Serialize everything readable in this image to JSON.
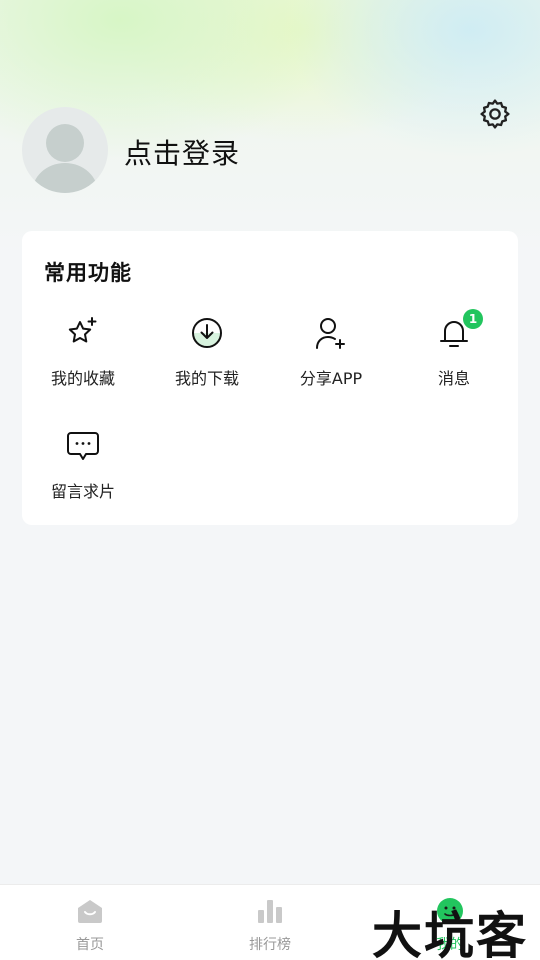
{
  "header": {
    "login_label": "点击登录",
    "settings_icon": "gear-icon",
    "avatar_icon": "default-avatar-icon"
  },
  "features_card": {
    "title": "常用功能",
    "items": [
      {
        "label": "我的收藏",
        "icon": "star-sparkle-icon"
      },
      {
        "label": "我的下载",
        "icon": "download-circle-icon"
      },
      {
        "label": "分享APP",
        "icon": "add-user-icon"
      },
      {
        "label": "消息",
        "icon": "bell-icon",
        "badge": "1"
      },
      {
        "label": "留言求片",
        "icon": "chat-bubble-icon"
      }
    ]
  },
  "tabbar": {
    "tabs": [
      {
        "label": "首页",
        "icon": "home-icon",
        "active": false
      },
      {
        "label": "排行榜",
        "icon": "bar-chart-icon",
        "active": false
      },
      {
        "label": "我的",
        "icon": "smile-face-icon",
        "active": true
      }
    ]
  },
  "watermark": {
    "text": "大坑客"
  },
  "colors": {
    "accent": "#22c55e",
    "background": "#f4f6f8",
    "card": "#ffffff",
    "tab_inactive": "#999999"
  }
}
